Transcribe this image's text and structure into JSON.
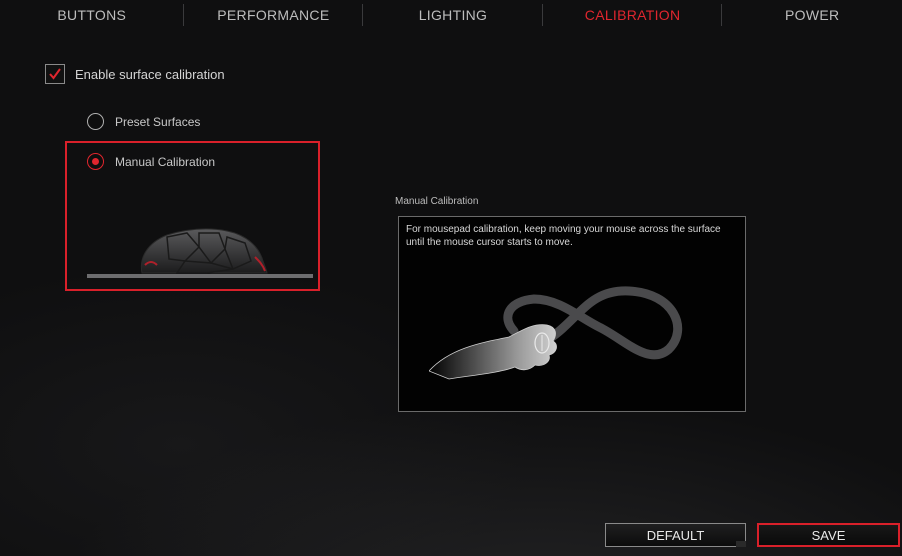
{
  "tabs": [
    {
      "label": "BUTTONS",
      "active": false
    },
    {
      "label": "PERFORMANCE",
      "active": false
    },
    {
      "label": "LIGHTING",
      "active": false
    },
    {
      "label": "CALIBRATION",
      "active": true
    },
    {
      "label": "POWER",
      "active": false
    }
  ],
  "calibration": {
    "enable_label": "Enable surface calibration",
    "enable_checked": true,
    "options": [
      {
        "label": "Preset Surfaces",
        "selected": false
      },
      {
        "label": "Manual Calibration",
        "selected": true
      }
    ]
  },
  "panel": {
    "title": "Manual Calibration",
    "description": "For mousepad calibration, keep moving your mouse across the surface until the mouse cursor starts to move."
  },
  "footer": {
    "default_label": "DEFAULT",
    "save_label": "SAVE"
  },
  "colors": {
    "accent": "#e0262e",
    "text": "#c9c9c9",
    "background": "#0f0f10"
  },
  "icons": {
    "checkbox": "checkmark-icon",
    "mouse": "gaming-mouse-icon",
    "panel": "hand-infinity-motion-illustration"
  }
}
